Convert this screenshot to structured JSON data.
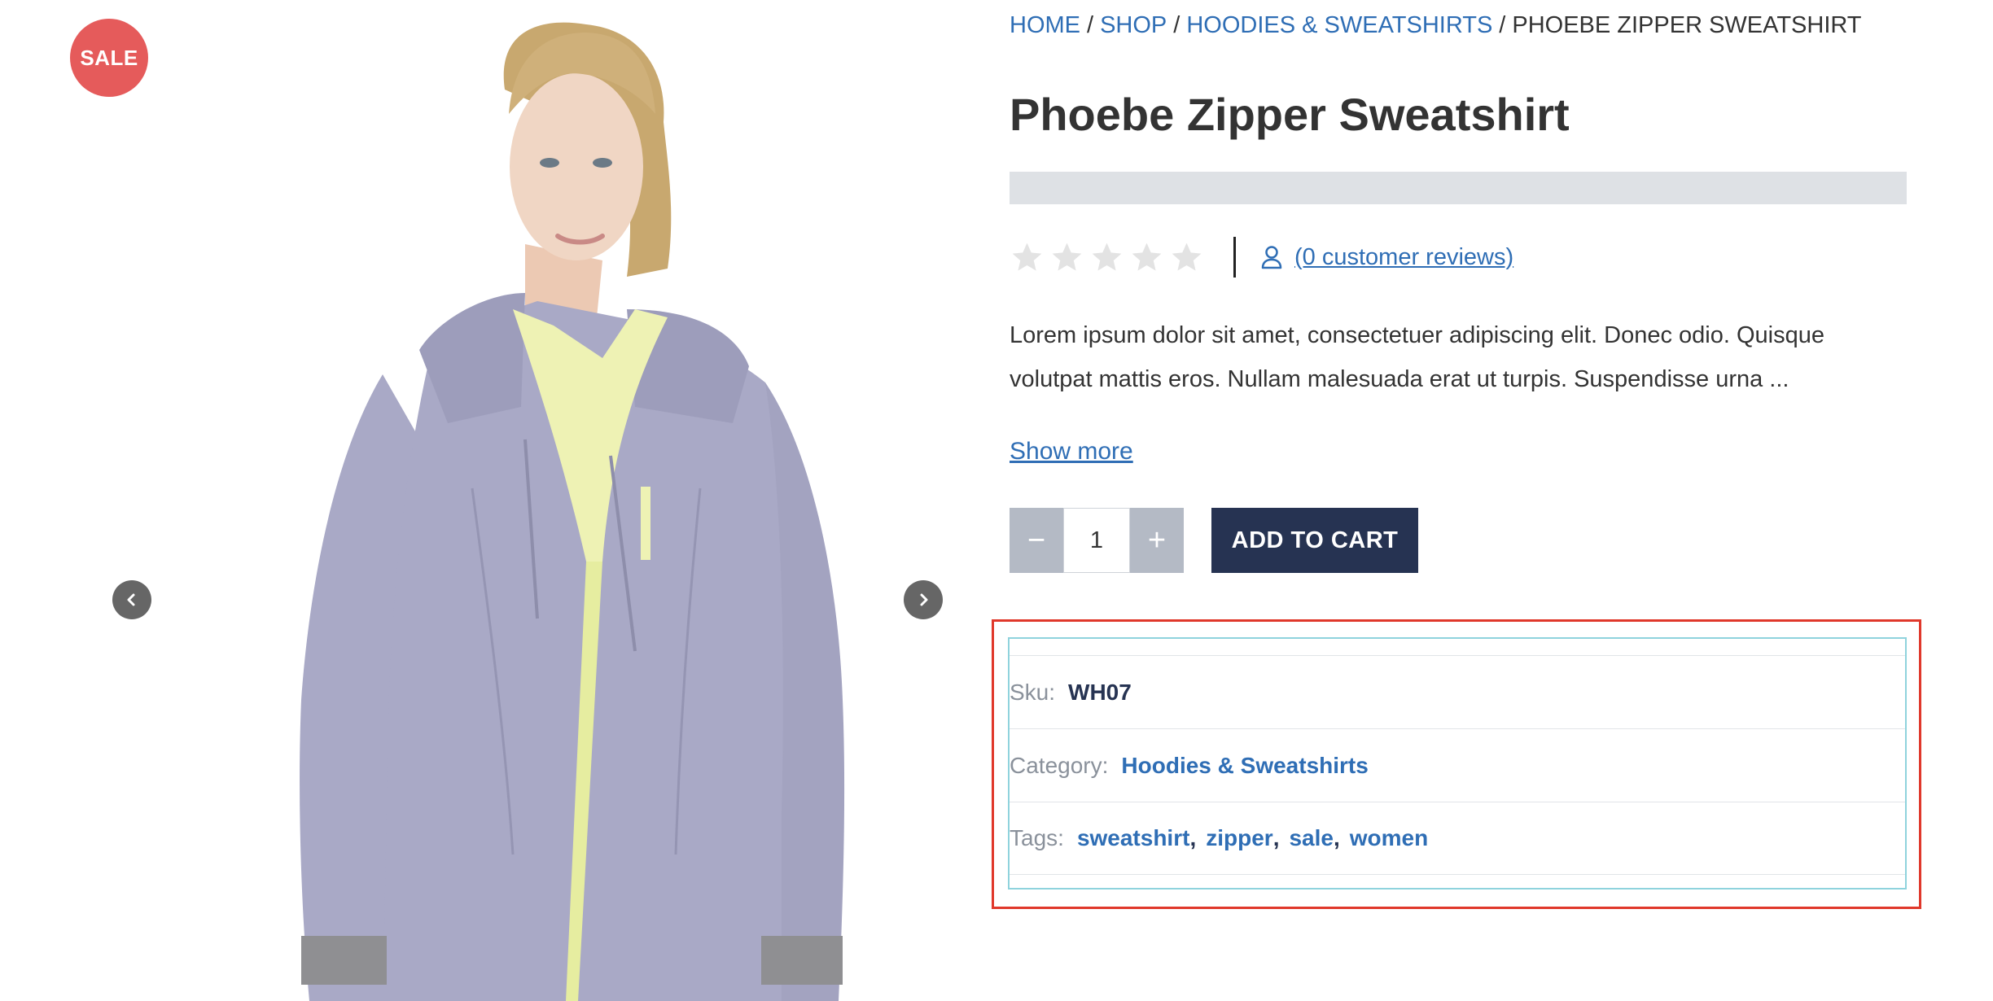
{
  "gallery": {
    "sale_badge": "SALE",
    "prev_icon": "chevron-left-icon",
    "next_icon": "chevron-right-icon",
    "image_alt": "Phoebe Zipper Sweatshirt",
    "colors": {
      "sweatshirt": "#a9a9c6",
      "lining": "#eef2b4",
      "skin": "#f0d6c4",
      "hair": "#c8a86f"
    }
  },
  "breadcrumb": {
    "items": [
      "HOME",
      "SHOP",
      "HOODIES & SWEATSHIRTS"
    ],
    "current": "PHOEBE ZIPPER SWEATSHIRT",
    "separator": "/"
  },
  "product": {
    "title": "Phoebe Zipper Sweatshirt",
    "rating": {
      "stars_filled": 0,
      "stars_total": 5,
      "reviews_label": "(0 customer reviews)",
      "reviews_icon": "user-icon"
    },
    "description": "Lorem ipsum dolor sit amet, consectetuer adipiscing elit. Donec odio. Quisque volutpat mattis eros. Nullam malesuada erat ut turpis. Suspendisse urna ...",
    "show_more": "Show more",
    "quantity": "1",
    "minus": "−",
    "plus": "+",
    "add_to_cart": "ADD TO CART"
  },
  "meta": {
    "sku_label": "Sku:",
    "sku_value": "WH07",
    "category_label": "Category:",
    "category_value": "Hoodies & Sweatshirts",
    "tags_label": "Tags:",
    "tags": [
      "sweatshirt",
      "zipper",
      "sale",
      "women"
    ],
    "tag_separator": ","
  },
  "colors": {
    "link": "#2f6eb5",
    "sale": "#e55b5b",
    "button_dark": "#263352",
    "qty_button": "#b4bac5",
    "highlight": "#e0382b",
    "placeholder": "#dee1e5"
  }
}
